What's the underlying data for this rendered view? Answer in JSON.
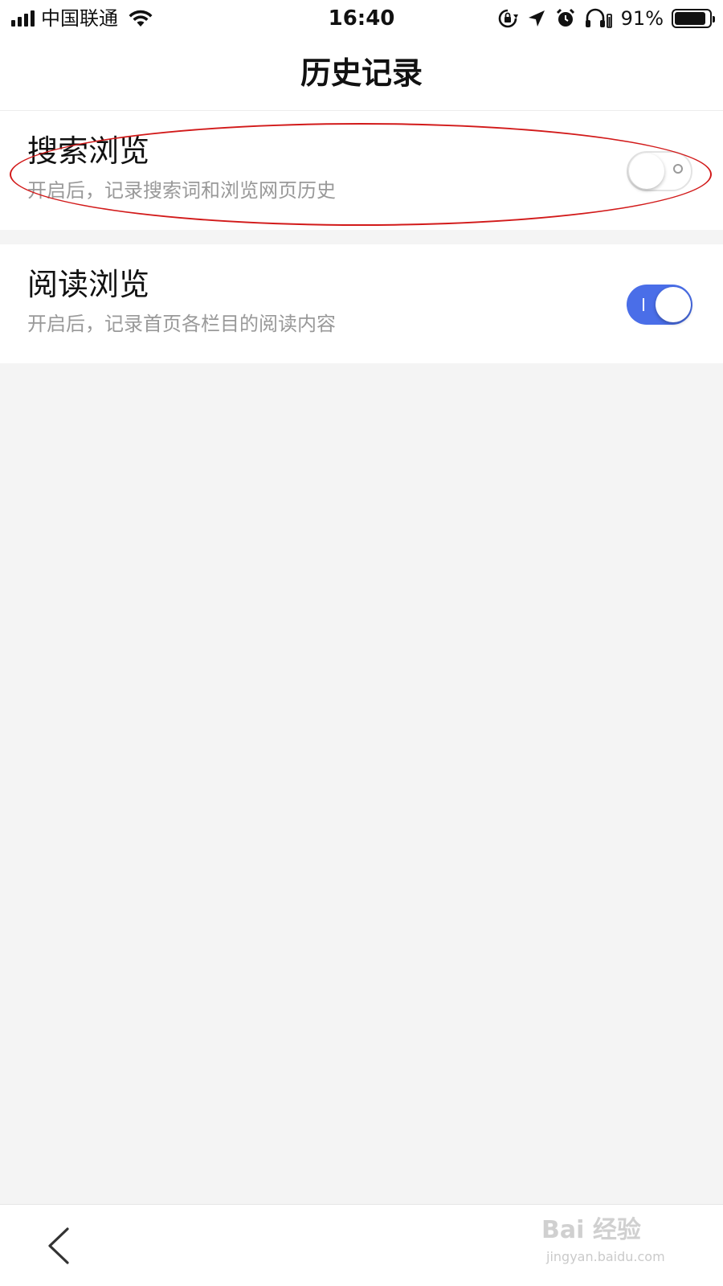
{
  "status_bar": {
    "carrier": "中国联通",
    "time": "16:40",
    "battery_percent_text": "91%",
    "battery_level": 0.91,
    "icons": [
      "signal-icon",
      "wifi-icon",
      "rotation-lock-icon",
      "location-arrow-icon",
      "alarm-icon",
      "headphones-icon",
      "battery-icon"
    ]
  },
  "header": {
    "title": "历史记录"
  },
  "settings": [
    {
      "title": "搜索浏览",
      "description": "开启后，记录搜索词和浏览网页历史",
      "enabled": false
    },
    {
      "title": "阅读浏览",
      "description": "开启后，记录首页各栏目的阅读内容",
      "enabled": true
    }
  ],
  "colors": {
    "toggle_on": "#4a6ee8",
    "annotation": "#d21a1a",
    "background": "#f4f4f4",
    "subtext": "#999999"
  },
  "watermark": {
    "logo_text": "Bai 经验",
    "url": "jingyan.baidu.com"
  }
}
